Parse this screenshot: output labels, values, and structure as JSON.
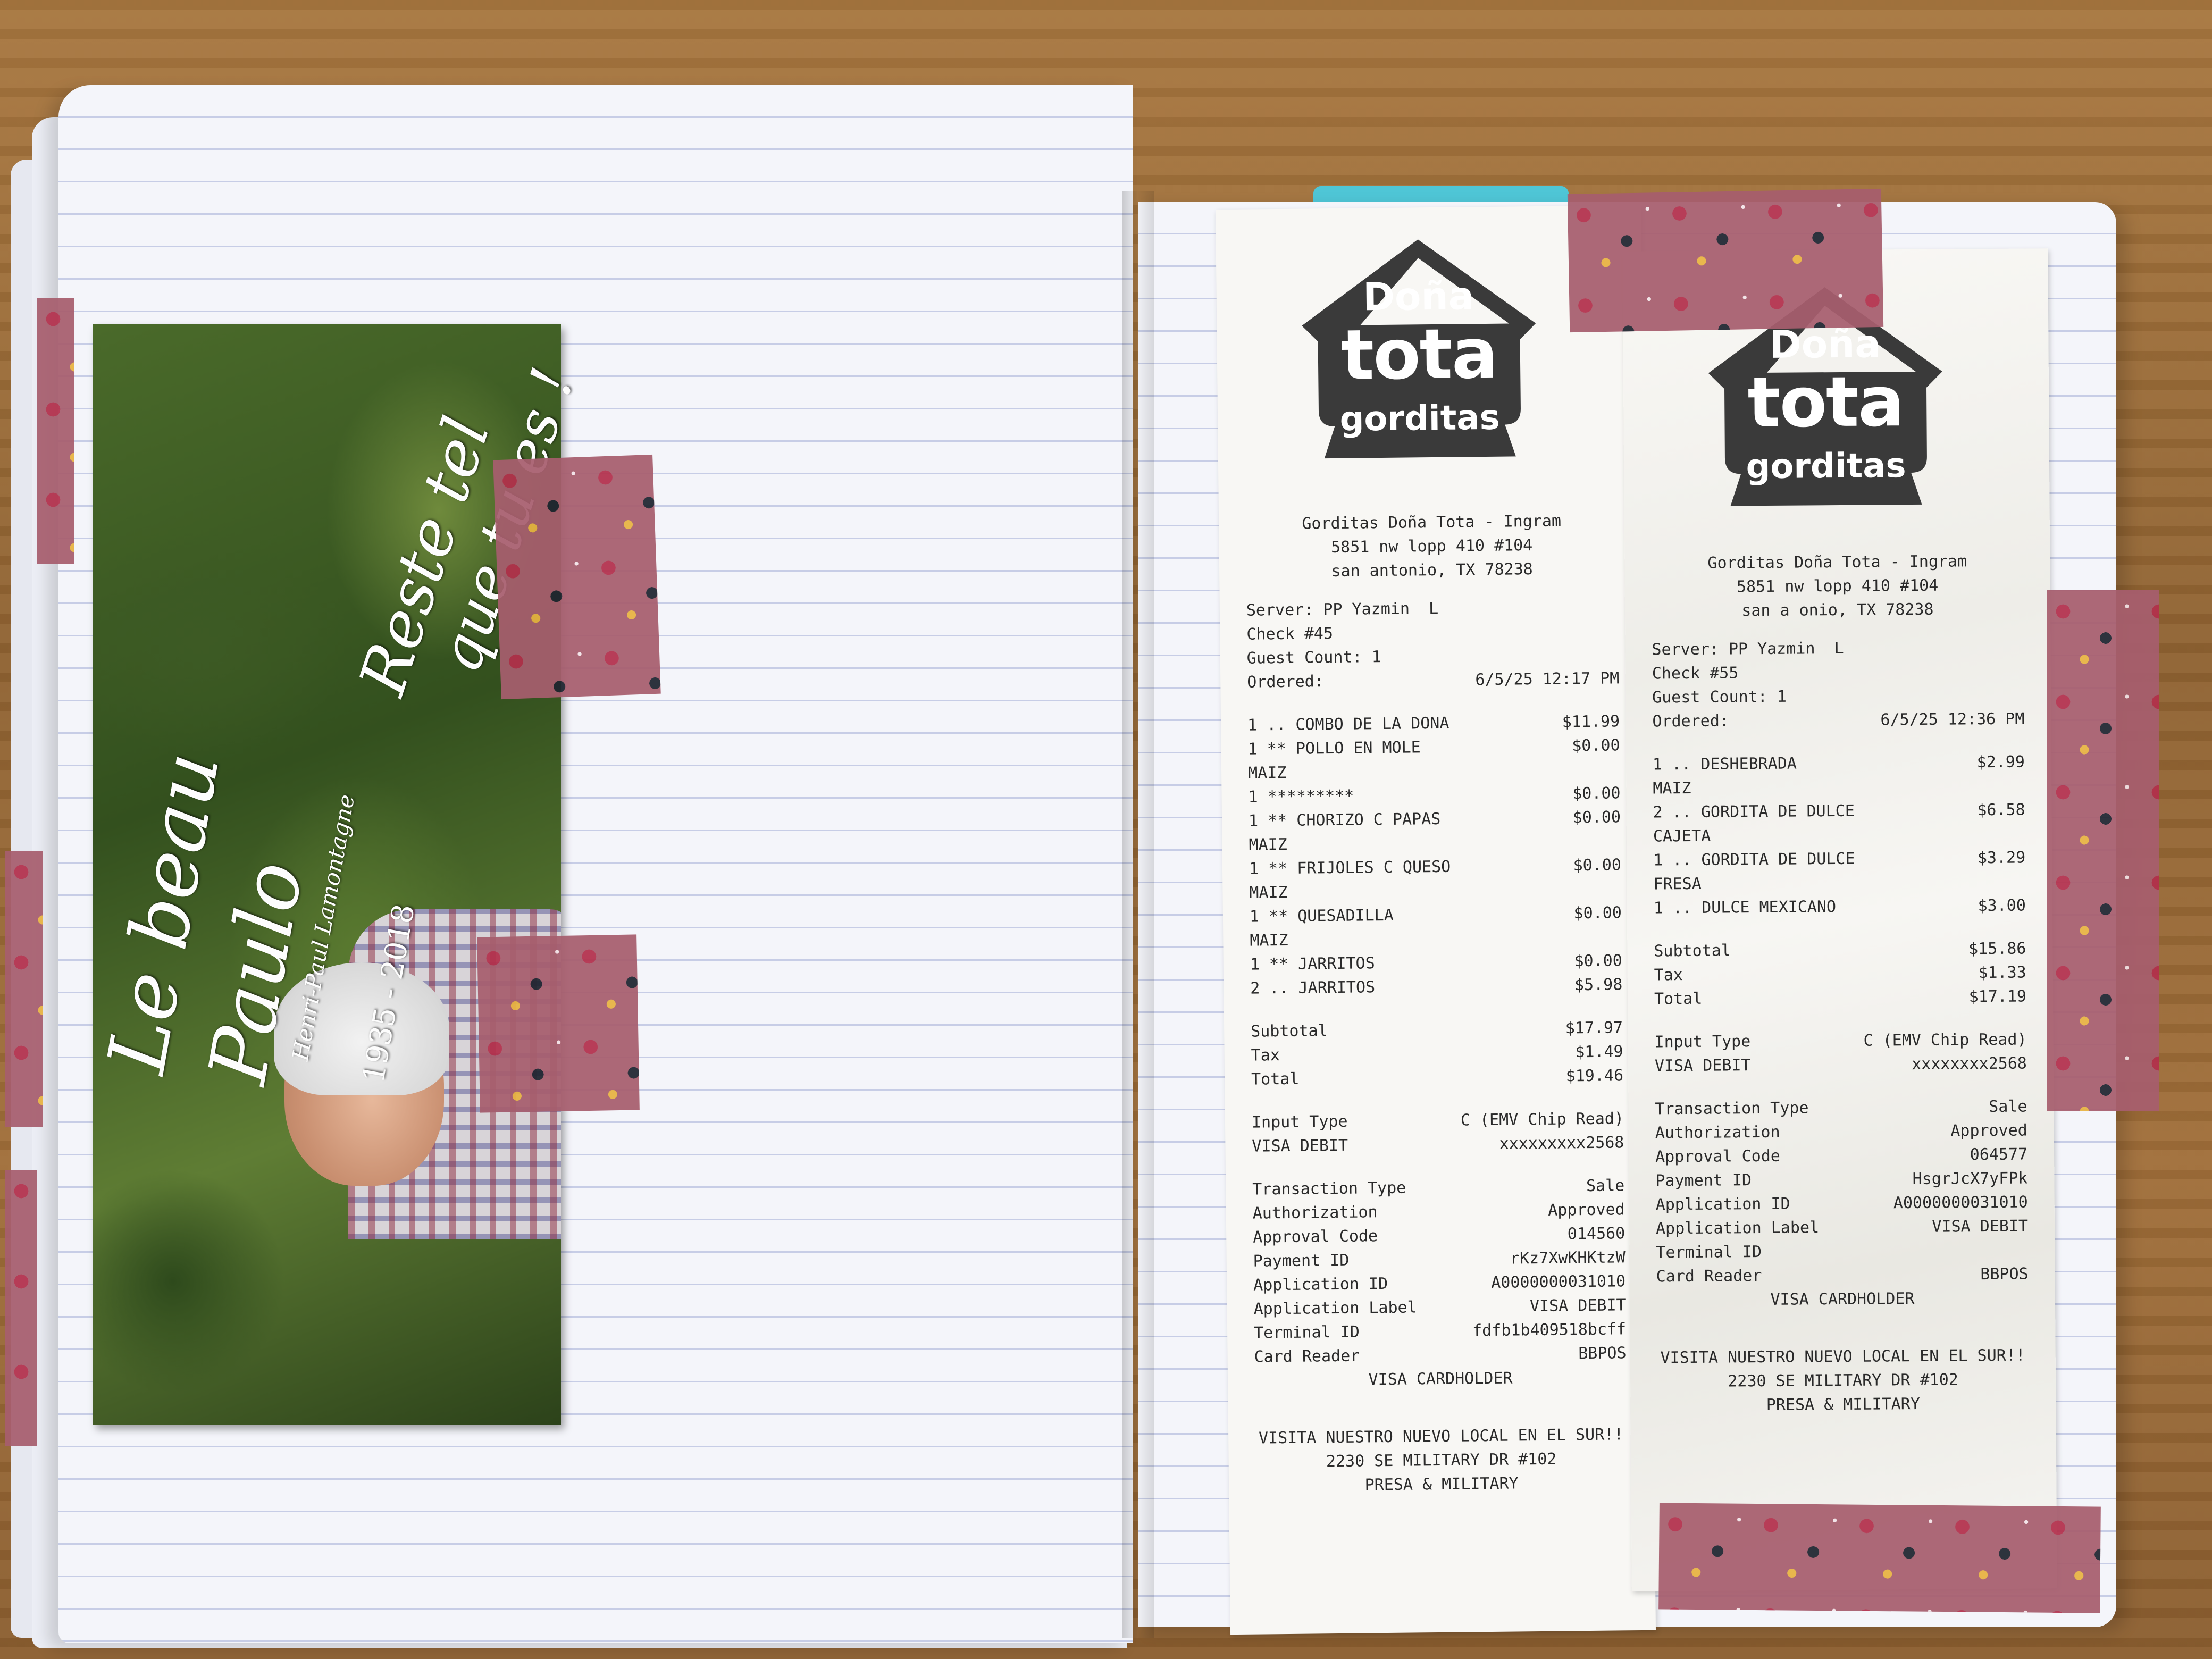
{
  "photo_card": {
    "quote_line1": "Reste tel",
    "quote_line2": "que tu es !",
    "title_line1": "Le beau",
    "title_line2": "Paulo",
    "full_name": "Henri-Paul Lamontagne",
    "years": "1935 - 2018"
  },
  "receipt_1": {
    "logo": {
      "line1": "Doña",
      "line2": "tota",
      "line3": "gorditas"
    },
    "header": [
      "Gorditas Doña Tota - Ingram",
      "5851 nw lopp 410 #104",
      "san antonio, TX 78238"
    ],
    "server": "Server: PP Yazmin  L",
    "check": "Check #45",
    "guest_count": "Guest Count: 1",
    "ordered_label": "Ordered:",
    "ordered_value": "6/5/25 12:17 PM",
    "items": [
      {
        "label": "1 .. COMBO DE LA DONA",
        "price": "$11.99"
      },
      {
        "label": "1 ** POLLO EN MOLE",
        "price": "$0.00"
      },
      {
        "label": "MAIZ",
        "price": ""
      },
      {
        "label": "1 *********",
        "price": "$0.00"
      },
      {
        "label": "1 ** CHORIZO C PAPAS",
        "price": "$0.00"
      },
      {
        "label": "MAIZ",
        "price": ""
      },
      {
        "label": "1 ** FRIJOLES C QUESO",
        "price": "$0.00"
      },
      {
        "label": "MAIZ",
        "price": ""
      },
      {
        "label": "1 ** QUESADILLA",
        "price": "$0.00"
      },
      {
        "label": "MAIZ",
        "price": ""
      },
      {
        "label": "1 ** JARRITOS",
        "price": "$0.00"
      },
      {
        "label": "2 .. JARRITOS",
        "price": "$5.98"
      }
    ],
    "totals": [
      {
        "label": "Subtotal",
        "value": "$17.97"
      },
      {
        "label": "Tax",
        "value": "$1.49"
      },
      {
        "label": "Total",
        "value": "$19.46"
      }
    ],
    "payment": [
      {
        "label": "Input Type",
        "value": "C (EMV Chip Read)"
      },
      {
        "label": "VISA DEBIT",
        "value": "xxxxxxxxx2568"
      }
    ],
    "transaction": [
      {
        "label": "Transaction Type",
        "value": "Sale"
      },
      {
        "label": "Authorization",
        "value": "Approved"
      },
      {
        "label": "Approval Code",
        "value": "014560"
      },
      {
        "label": "Payment ID",
        "value": "rKz7XwKHKtzW"
      },
      {
        "label": "Application ID",
        "value": "A0000000031010"
      },
      {
        "label": "Application Label",
        "value": "VISA DEBIT"
      },
      {
        "label": "Terminal ID",
        "value": "fdfb1b409518bcff"
      },
      {
        "label": "Card Reader",
        "value": "BBPOS"
      }
    ],
    "cardholder": "VISA CARDHOLDER",
    "footer": [
      "VISITA NUESTRO NUEVO LOCAL EN EL SUR!!",
      "2230 SE MILITARY DR #102",
      "PRESA & MILITARY"
    ]
  },
  "receipt_2": {
    "logo": {
      "line1": "Doña",
      "line2": "tota",
      "line3": "gorditas"
    },
    "header": [
      "Gorditas Doña Tota - Ingram",
      "5851 nw lopp 410 #104",
      "san a onio, TX 78238"
    ],
    "server": "Server: PP Yazmin  L",
    "check": "Check #55",
    "guest_count": "Guest Count: 1",
    "ordered_label": "Ordered:",
    "ordered_value": "6/5/25 12:36 PM",
    "items": [
      {
        "label": "1 .. DESHEBRADA",
        "price": "$2.99"
      },
      {
        "label": "MAIZ",
        "price": ""
      },
      {
        "label": "2 .. GORDITA DE DULCE",
        "price": "$6.58"
      },
      {
        "label": "CAJETA",
        "price": ""
      },
      {
        "label": "1 .. GORDITA DE DULCE",
        "price": "$3.29"
      },
      {
        "label": "FRESA",
        "price": ""
      },
      {
        "label": "1 .. DULCE MEXICANO",
        "price": "$3.00"
      }
    ],
    "totals": [
      {
        "label": "Subtotal",
        "value": "$15.86"
      },
      {
        "label": "Tax",
        "value": "$1.33"
      },
      {
        "label": "Total",
        "value": "$17.19"
      }
    ],
    "payment": [
      {
        "label": "Input Type",
        "value": "C (EMV Chip Read)"
      },
      {
        "label": "VISA DEBIT",
        "value": "xxxxxxxx2568"
      }
    ],
    "transaction": [
      {
        "label": "Transaction Type",
        "value": "Sale"
      },
      {
        "label": "Authorization",
        "value": "Approved"
      },
      {
        "label": "Approval Code",
        "value": "064577"
      },
      {
        "label": "Payment ID",
        "value": "HsgrJcX7yFPk"
      },
      {
        "label": "Application ID",
        "value": "A0000000031010"
      },
      {
        "label": "Application Label",
        "value": "VISA DEBIT"
      },
      {
        "label": "Terminal ID",
        "value": ""
      },
      {
        "label": "Card Reader",
        "value": "BBPOS"
      }
    ],
    "cardholder": "VISA CARDHOLDER",
    "footer": [
      "VISITA NUESTRO NUEVO LOCAL EN EL SUR!!",
      "2230 SE MILITARY DR #102",
      "PRESA & MILITARY"
    ]
  }
}
